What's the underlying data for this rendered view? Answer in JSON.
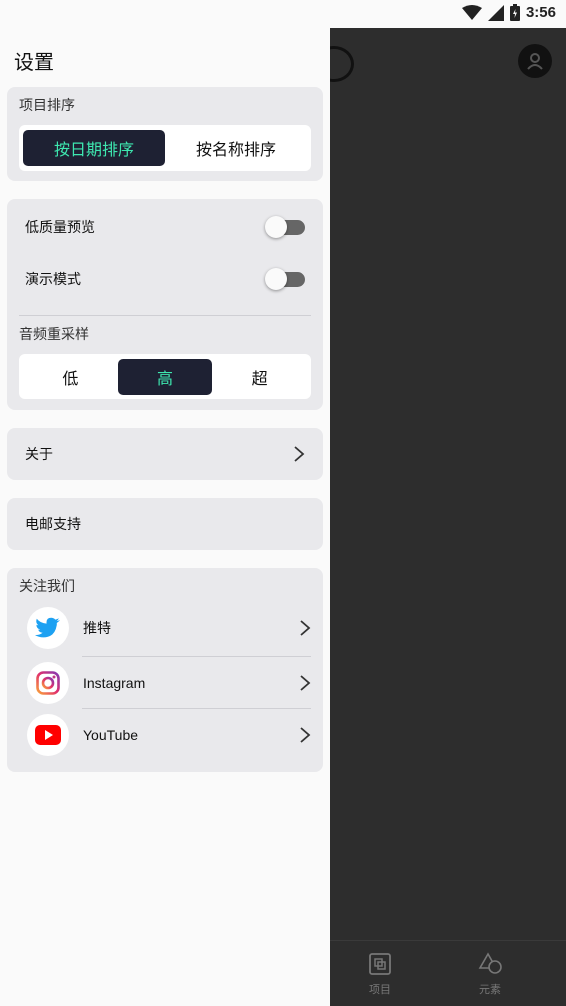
{
  "status_bar": {
    "time": "3:56",
    "wifi_icon": "wifi-icon",
    "signal_icon": "signal-icon",
    "battery_icon": "battery-icon"
  },
  "drawer": {
    "title": "设置",
    "sort": {
      "label": "项目排序",
      "options": [
        "按日期排序",
        "按名称排序"
      ],
      "selected": "按日期排序"
    },
    "preview": {
      "low_quality_label": "低质量预览",
      "low_quality_on": false,
      "demo_mode_label": "演示模式",
      "demo_mode_on": false,
      "resample_label": "音频重采样",
      "resample_options": [
        "低",
        "高",
        "超"
      ],
      "resample_selected": "高"
    },
    "about_label": "关于",
    "email_label": "电邮支持",
    "follow": {
      "label": "关注我们",
      "items": [
        {
          "label": "推特",
          "icon": "twitter-icon"
        },
        {
          "label": "Instagram",
          "icon": "instagram-icon"
        },
        {
          "label": "YouTube",
          "icon": "youtube-icon"
        }
      ]
    }
  },
  "background_app": {
    "tabs": [
      {
        "label": "项目",
        "icon": "projects-icon"
      },
      {
        "label": "元素",
        "icon": "elements-icon"
      }
    ]
  },
  "colors": {
    "accent": "#3ee8b0",
    "segment_active_bg": "#1e2133",
    "card_bg": "#e9e9ec",
    "backdrop": "#2d2d2d"
  }
}
